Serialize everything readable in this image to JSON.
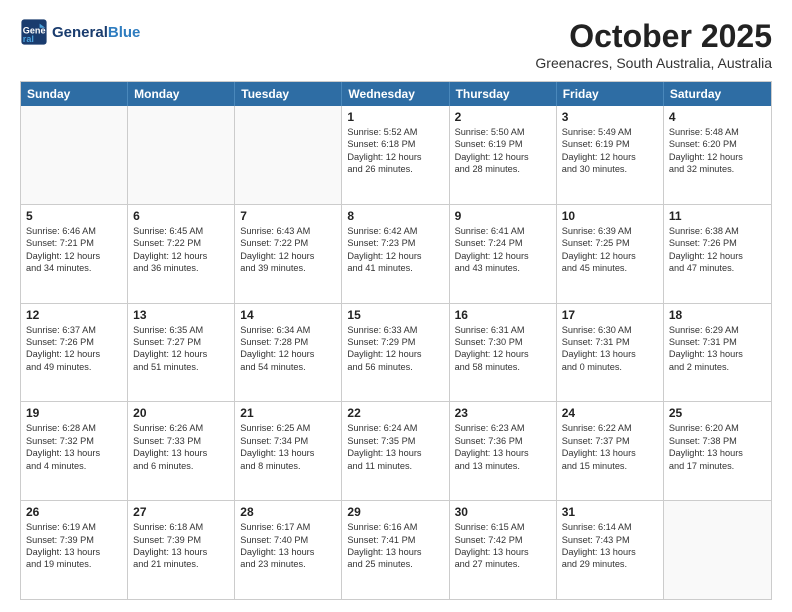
{
  "header": {
    "logo_line1": "General",
    "logo_line2": "Blue",
    "month": "October 2025",
    "location": "Greenacres, South Australia, Australia"
  },
  "weekdays": [
    "Sunday",
    "Monday",
    "Tuesday",
    "Wednesday",
    "Thursday",
    "Friday",
    "Saturday"
  ],
  "rows": [
    [
      {
        "day": "",
        "text": ""
      },
      {
        "day": "",
        "text": ""
      },
      {
        "day": "",
        "text": ""
      },
      {
        "day": "1",
        "text": "Sunrise: 5:52 AM\nSunset: 6:18 PM\nDaylight: 12 hours\nand 26 minutes."
      },
      {
        "day": "2",
        "text": "Sunrise: 5:50 AM\nSunset: 6:19 PM\nDaylight: 12 hours\nand 28 minutes."
      },
      {
        "day": "3",
        "text": "Sunrise: 5:49 AM\nSunset: 6:19 PM\nDaylight: 12 hours\nand 30 minutes."
      },
      {
        "day": "4",
        "text": "Sunrise: 5:48 AM\nSunset: 6:20 PM\nDaylight: 12 hours\nand 32 minutes."
      }
    ],
    [
      {
        "day": "5",
        "text": "Sunrise: 6:46 AM\nSunset: 7:21 PM\nDaylight: 12 hours\nand 34 minutes."
      },
      {
        "day": "6",
        "text": "Sunrise: 6:45 AM\nSunset: 7:22 PM\nDaylight: 12 hours\nand 36 minutes."
      },
      {
        "day": "7",
        "text": "Sunrise: 6:43 AM\nSunset: 7:22 PM\nDaylight: 12 hours\nand 39 minutes."
      },
      {
        "day": "8",
        "text": "Sunrise: 6:42 AM\nSunset: 7:23 PM\nDaylight: 12 hours\nand 41 minutes."
      },
      {
        "day": "9",
        "text": "Sunrise: 6:41 AM\nSunset: 7:24 PM\nDaylight: 12 hours\nand 43 minutes."
      },
      {
        "day": "10",
        "text": "Sunrise: 6:39 AM\nSunset: 7:25 PM\nDaylight: 12 hours\nand 45 minutes."
      },
      {
        "day": "11",
        "text": "Sunrise: 6:38 AM\nSunset: 7:26 PM\nDaylight: 12 hours\nand 47 minutes."
      }
    ],
    [
      {
        "day": "12",
        "text": "Sunrise: 6:37 AM\nSunset: 7:26 PM\nDaylight: 12 hours\nand 49 minutes."
      },
      {
        "day": "13",
        "text": "Sunrise: 6:35 AM\nSunset: 7:27 PM\nDaylight: 12 hours\nand 51 minutes."
      },
      {
        "day": "14",
        "text": "Sunrise: 6:34 AM\nSunset: 7:28 PM\nDaylight: 12 hours\nand 54 minutes."
      },
      {
        "day": "15",
        "text": "Sunrise: 6:33 AM\nSunset: 7:29 PM\nDaylight: 12 hours\nand 56 minutes."
      },
      {
        "day": "16",
        "text": "Sunrise: 6:31 AM\nSunset: 7:30 PM\nDaylight: 12 hours\nand 58 minutes."
      },
      {
        "day": "17",
        "text": "Sunrise: 6:30 AM\nSunset: 7:31 PM\nDaylight: 13 hours\nand 0 minutes."
      },
      {
        "day": "18",
        "text": "Sunrise: 6:29 AM\nSunset: 7:31 PM\nDaylight: 13 hours\nand 2 minutes."
      }
    ],
    [
      {
        "day": "19",
        "text": "Sunrise: 6:28 AM\nSunset: 7:32 PM\nDaylight: 13 hours\nand 4 minutes."
      },
      {
        "day": "20",
        "text": "Sunrise: 6:26 AM\nSunset: 7:33 PM\nDaylight: 13 hours\nand 6 minutes."
      },
      {
        "day": "21",
        "text": "Sunrise: 6:25 AM\nSunset: 7:34 PM\nDaylight: 13 hours\nand 8 minutes."
      },
      {
        "day": "22",
        "text": "Sunrise: 6:24 AM\nSunset: 7:35 PM\nDaylight: 13 hours\nand 11 minutes."
      },
      {
        "day": "23",
        "text": "Sunrise: 6:23 AM\nSunset: 7:36 PM\nDaylight: 13 hours\nand 13 minutes."
      },
      {
        "day": "24",
        "text": "Sunrise: 6:22 AM\nSunset: 7:37 PM\nDaylight: 13 hours\nand 15 minutes."
      },
      {
        "day": "25",
        "text": "Sunrise: 6:20 AM\nSunset: 7:38 PM\nDaylight: 13 hours\nand 17 minutes."
      }
    ],
    [
      {
        "day": "26",
        "text": "Sunrise: 6:19 AM\nSunset: 7:39 PM\nDaylight: 13 hours\nand 19 minutes."
      },
      {
        "day": "27",
        "text": "Sunrise: 6:18 AM\nSunset: 7:39 PM\nDaylight: 13 hours\nand 21 minutes."
      },
      {
        "day": "28",
        "text": "Sunrise: 6:17 AM\nSunset: 7:40 PM\nDaylight: 13 hours\nand 23 minutes."
      },
      {
        "day": "29",
        "text": "Sunrise: 6:16 AM\nSunset: 7:41 PM\nDaylight: 13 hours\nand 25 minutes."
      },
      {
        "day": "30",
        "text": "Sunrise: 6:15 AM\nSunset: 7:42 PM\nDaylight: 13 hours\nand 27 minutes."
      },
      {
        "day": "31",
        "text": "Sunrise: 6:14 AM\nSunset: 7:43 PM\nDaylight: 13 hours\nand 29 minutes."
      },
      {
        "day": "",
        "text": ""
      }
    ]
  ]
}
